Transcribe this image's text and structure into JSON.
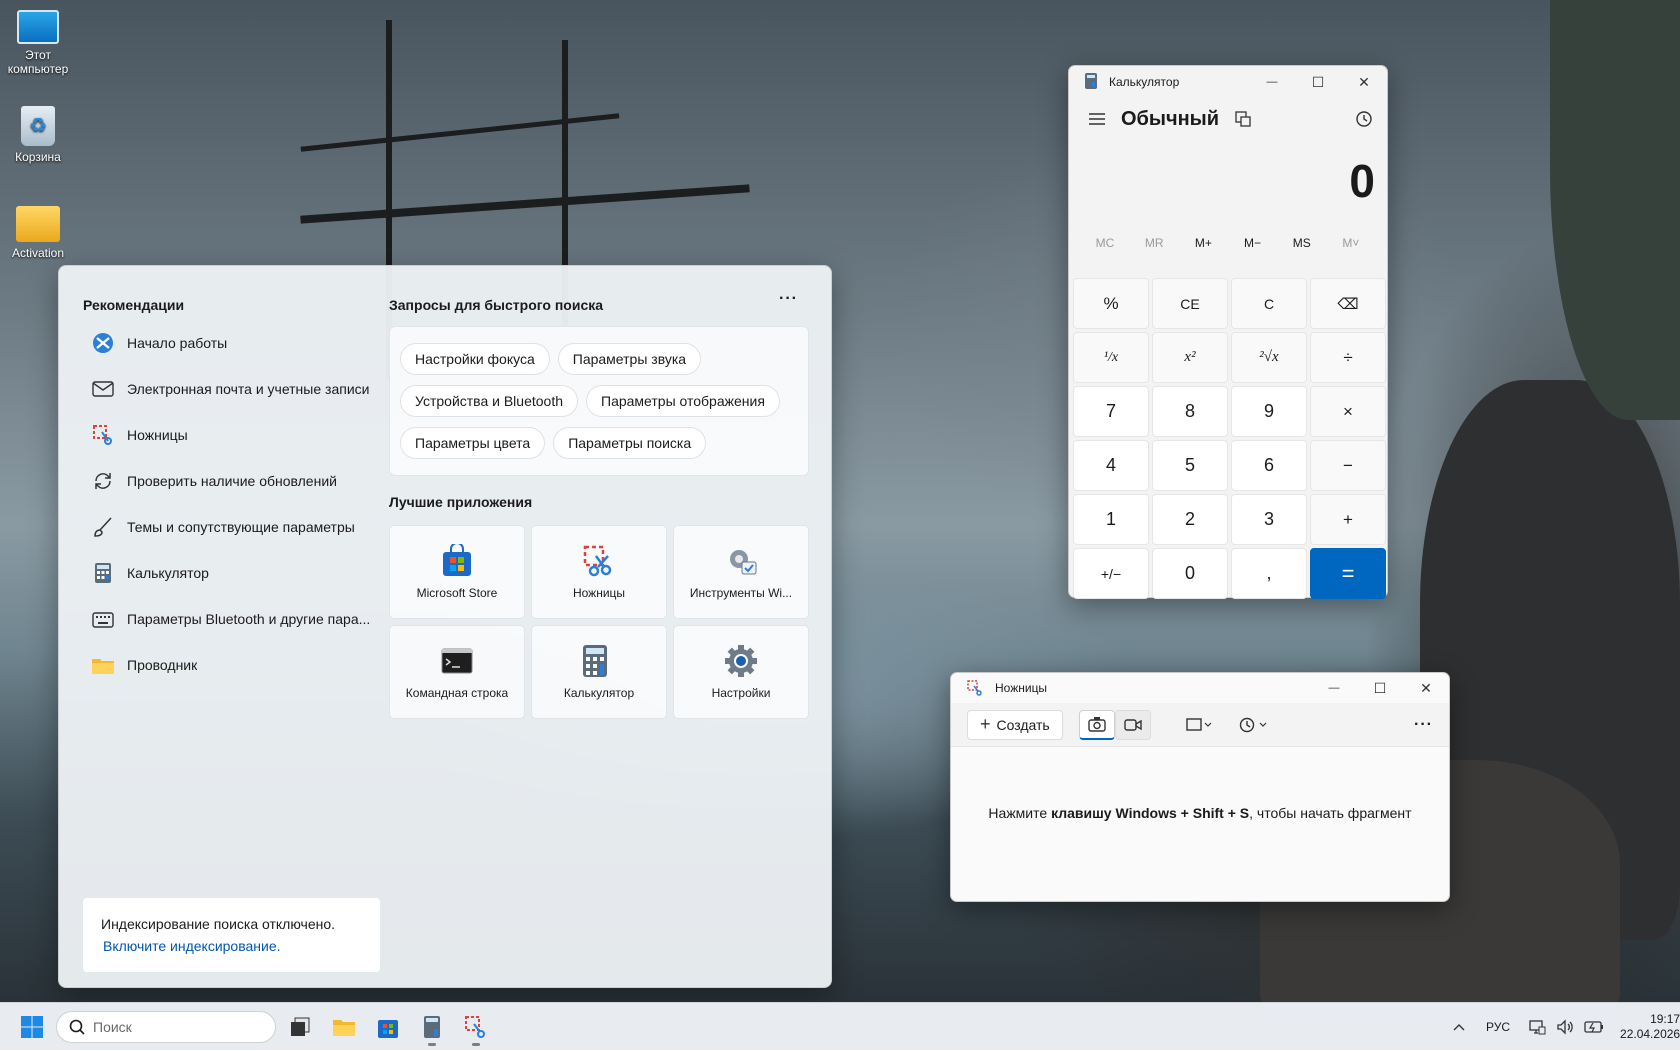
{
  "desktop": {
    "icons": [
      {
        "label": "Этот компьютер",
        "icon": "monitor-icon"
      },
      {
        "label": "Корзина",
        "icon": "recycle-bin-icon"
      },
      {
        "label": "Activation",
        "icon": "folder-icon"
      }
    ]
  },
  "start_menu": {
    "recommendations_title": "Рекомендации",
    "recommendations": [
      {
        "label": "Начало работы",
        "icon": "get-started-icon"
      },
      {
        "label": "Электронная почта и учетные записи",
        "icon": "mail-icon"
      },
      {
        "label": "Ножницы",
        "icon": "snipping-icon"
      },
      {
        "label": "Проверить наличие обновлений",
        "icon": "sync-icon"
      },
      {
        "label": "Темы и сопутствующие параметры",
        "icon": "brush-icon"
      },
      {
        "label": "Калькулятор",
        "icon": "calculator-icon"
      },
      {
        "label": "Параметры Bluetooth и другие пара...",
        "icon": "keyboard-icon"
      },
      {
        "label": "Проводник",
        "icon": "folder-icon"
      }
    ],
    "quick_search_title": "Запросы для быстрого поиска",
    "more_label": "···",
    "quick_search": [
      [
        "Настройки фокуса",
        "Параметры звука"
      ],
      [
        "Устройства и Bluetooth",
        "Параметры отображения"
      ],
      [
        "Параметры цвета",
        "Параметры поиска"
      ]
    ],
    "top_apps_title": "Лучшие приложения",
    "top_apps": [
      {
        "label": "Microsoft Store",
        "icon": "store-icon"
      },
      {
        "label": "Ножницы",
        "icon": "snipping-icon"
      },
      {
        "label": "Инструменты Wi...",
        "icon": "tools-icon"
      },
      {
        "label": "Командная строка",
        "icon": "terminal-icon"
      },
      {
        "label": "Калькулятор",
        "icon": "calculator-icon"
      },
      {
        "label": "Настройки",
        "icon": "gear-icon"
      }
    ],
    "indexing": {
      "text": "Индексирование поиска отключено.",
      "link": "Включите индексирование."
    }
  },
  "calculator": {
    "title": "Калькулятор",
    "mode": "Обычный",
    "display": "0",
    "memory": [
      "MC",
      "MR",
      "M+",
      "M−",
      "MS",
      "M˅"
    ],
    "keys": [
      "%",
      "CE",
      "C",
      "⌫",
      "¹/x",
      "x²",
      "²√x",
      "÷",
      "7",
      "8",
      "9",
      "×",
      "4",
      "5",
      "6",
      "−",
      "1",
      "2",
      "3",
      "+",
      "+/−",
      "0",
      ",",
      "="
    ],
    "window_controls": [
      "—",
      "☐",
      "✕"
    ]
  },
  "snipping": {
    "title": "Ножницы",
    "new_label": "Создать",
    "more_label": "···",
    "message_pre": "Нажмите ",
    "message_bold": "клавишу Windows + Shift + S",
    "message_post": ", чтобы начать фрагмент"
  },
  "taskbar": {
    "search_placeholder": "Поиск",
    "lang": "РУС",
    "time": "19:17",
    "date": "22.04.2026"
  },
  "colors": {
    "accent": "#0067c0",
    "link": "#0056b0"
  }
}
